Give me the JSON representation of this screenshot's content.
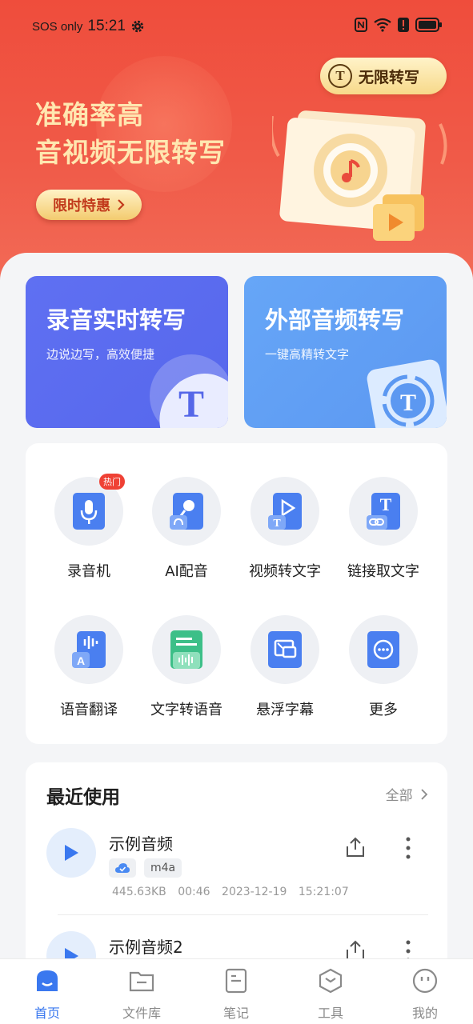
{
  "status_bar": {
    "carrier": "SOS only",
    "time": "15:21"
  },
  "banner": {
    "promo_pill": "无限转写",
    "headline_line1": "准确率高",
    "headline_line2": "音视频无限转写",
    "offer_button": "限时特惠"
  },
  "cards": [
    {
      "title": "录音实时转写",
      "subtitle": "边说边写，高效便捷"
    },
    {
      "title": "外部音频转写",
      "subtitle": "一键高精转文字"
    }
  ],
  "tools": [
    {
      "label": "录音机",
      "icon": "microphone-icon",
      "badge": "热门"
    },
    {
      "label": "AI配音",
      "icon": "ai-dubbing-icon"
    },
    {
      "label": "视频转文字",
      "icon": "video-to-text-icon"
    },
    {
      "label": "链接取文字",
      "icon": "link-text-icon"
    },
    {
      "label": "语音翻译",
      "icon": "voice-translate-icon"
    },
    {
      "label": "文字转语音",
      "icon": "text-to-speech-icon"
    },
    {
      "label": "悬浮字幕",
      "icon": "floating-subtitle-icon"
    },
    {
      "label": "更多",
      "icon": "more-icon"
    }
  ],
  "recent": {
    "title": "最近使用",
    "all_label": "全部",
    "items": [
      {
        "name": "示例音频",
        "format": "m4a",
        "size": "445.63KB",
        "duration": "00:46",
        "date": "2023-12-19 15:21:07"
      },
      {
        "name": "示例音频2"
      }
    ]
  },
  "nav": [
    {
      "label": "首页",
      "active": true
    },
    {
      "label": "文件库"
    },
    {
      "label": "笔记"
    },
    {
      "label": "工具"
    },
    {
      "label": "我的"
    }
  ],
  "colors": {
    "accent": "#3a78ef",
    "banner": "#ef4d3c",
    "card_left": "#5f70f2",
    "card_right": "#66a6f7"
  }
}
